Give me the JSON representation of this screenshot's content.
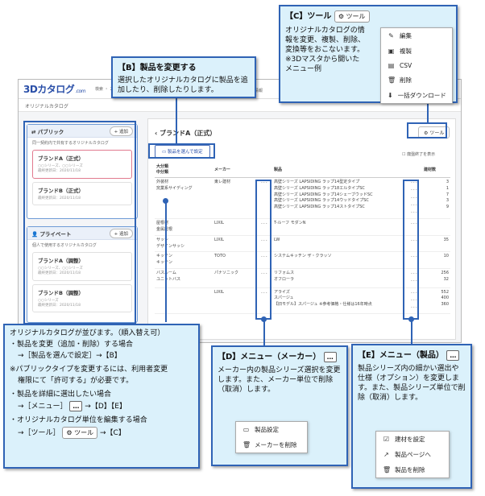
{
  "app": {
    "logo": "3Dカタログ",
    "logo_suffix": ".com",
    "nav_left": "検索 ・ カ ・ ・ ・",
    "nav_right": "情報",
    "breadcrumb": "オリジナルカタログ"
  },
  "public_panel": {
    "title": "パブリック",
    "add_label": "追加",
    "description": "同一契約内で共有するオリジナルカタログ",
    "cards": [
      {
        "name": "ブランドA（正式）",
        "sub": "○○シリーズ、○○シリーズ",
        "date": "最終更新日：2020/11/18"
      },
      {
        "name": "ブランドB（正式）",
        "sub": "",
        "date": "最終更新日：2020/11/18"
      }
    ]
  },
  "private_panel": {
    "title": "プライベート",
    "add_label": "追加",
    "description": "個人で使用するオリジナルカタログ",
    "cards": [
      {
        "name": "ブランドA（調整）",
        "sub": "○○シリーズ、○○シリーズ",
        "date": "最終更新日：2020/11/18"
      },
      {
        "name": "ブランドB（調整）",
        "sub": "○○シリーズ",
        "date": "最終更新日：2020/11/18"
      }
    ]
  },
  "main": {
    "title": "ブランドA（正式）",
    "tool_label": "ツール",
    "select_label": "製品を選んで設定",
    "checkbox_label": "廃盤終了を表示",
    "headers": {
      "category_major": "大分類",
      "category_minor": "中分類",
      "maker": "メーカー",
      "product": "製品",
      "count": "建材数"
    },
    "rows": [
      {
        "cat1": "外装材",
        "cat2": "窯業系サイディング",
        "maker": "東レ建材",
        "products": [
          "高壁シリーズ LAPSIDING ラップ14型定タイプ",
          "高壁シリーズ LAPSIDING ラップ18エルタイプSC",
          "高壁シリーズ LAPSIDING ラップ14シェーブウッドSC",
          "高壁シリーズ LAPSIDING ラップ14ウッドタイプSC",
          "高壁シリーズ LAPSIDING ラップ14ストタイプSC"
        ],
        "counts": [
          "3",
          "1",
          "7",
          "3",
          "9"
        ]
      },
      {
        "cat1": "屋根材",
        "cat2": "金属屋根",
        "maker": "LIXIL",
        "products": [
          "T-ルーフ モダンN"
        ],
        "counts": [
          ""
        ]
      },
      {
        "cat1": "サッシ",
        "cat2": "デザインサッシ",
        "maker": "LIXIL",
        "products": [
          "LW"
        ],
        "counts": [
          "35"
        ]
      },
      {
        "cat1": "キッチン",
        "cat2": "キッチン",
        "maker": "TOTO",
        "products": [
          "システムキッチン ザ・クラッソ"
        ],
        "counts": [
          "10"
        ]
      },
      {
        "cat1": "バスルーム",
        "cat2": "ユニットバス",
        "maker": "パナソニック",
        "products": [
          "リフォムス",
          "オフローラ"
        ],
        "counts": [
          "256",
          "32"
        ]
      },
      {
        "cat1": "",
        "cat2": "",
        "maker": "LIXIL",
        "products": [
          "アライズ",
          "スパージュ",
          "【旧モデル】スパージュ ※参考価格・仕様は16年時点"
        ],
        "counts": [
          "552",
          "400",
          "360"
        ]
      }
    ]
  },
  "callout_c": {
    "head": "【C】ツール",
    "badge": "ツール",
    "body": "オリジナルカタログの情報を変更、複製、削除、変換等をおこないます。※3Dマスタから開いたメニュー例",
    "menu": [
      "編集",
      "複製",
      "CSV",
      "削除",
      "一括ダウンロード"
    ]
  },
  "callout_b": {
    "head": "【B】製品を変更する",
    "body": "選択したオリジナルカタログに製品を追加したり、削除したりします。"
  },
  "callout_a": {
    "line1": "オリジナルカタログが並びます。（順入替え可）",
    "line2": "・製品を変更（追加・削除）する場合",
    "line3": "→［製品を選んで設定］→【B】",
    "line4": "※パブリックタイプを変更するには、利用者変更",
    "line5": "権限にて「許可する」が必要です。",
    "line6": "・製品を詳細に選出したい場合",
    "line7a": "→［メニュー］",
    "line7b": "→【D】【E】",
    "line8": "・オリジナルカタログ単位を編集する場合",
    "line9a": "→［ツール］",
    "line9b": "→【C】",
    "tool_badge": "ツール",
    "dots": "…"
  },
  "callout_d": {
    "head": "【D】メニュー（メーカー）",
    "dots": "…",
    "body": "メーカー内の製品シリーズ選択を変更します。また、メーカー単位で削除（取消）します。",
    "menu": [
      "製品設定",
      "メーカーを削除"
    ]
  },
  "callout_e": {
    "head": "【E】メニュー（製品）",
    "dots": "…",
    "body": "製品シリーズ内の細かい選出や仕様（オプション）を変更します。また、製品シリーズ単位で削除（取消）します。",
    "menu": [
      "建材を設定",
      "製品ページへ",
      "製品を削除"
    ]
  },
  "colors": {
    "accent": "#2f63b5",
    "callout_bg": "#dbf1fb",
    "selected_border": "#e17a8e"
  }
}
